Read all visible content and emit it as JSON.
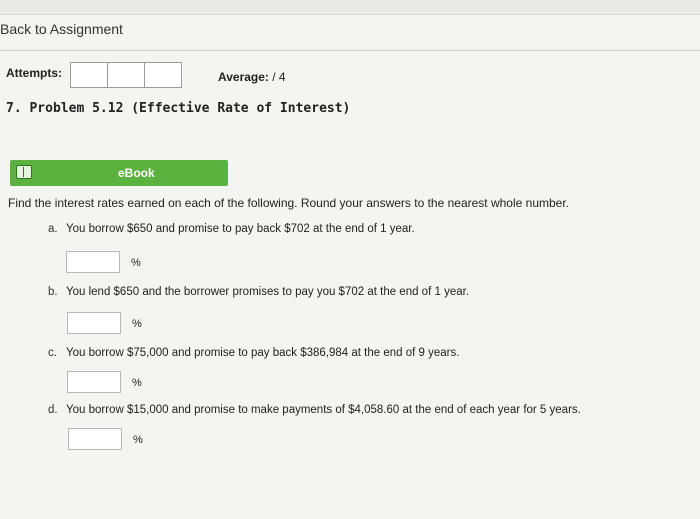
{
  "nav": {
    "back_label": "Back to Assignment"
  },
  "header": {
    "attempts_label": "Attempts:",
    "average_label": "Average:",
    "average_value": "/ 4"
  },
  "problem": {
    "title": "7. Problem 5.12 (Effective Rate of Interest)"
  },
  "ebook": {
    "label": "eBook"
  },
  "instructions": "Find the interest rates earned on each of the following. Round your answers to the nearest whole number.",
  "questions": [
    {
      "letter": "a.",
      "text": "You borrow $650 and promise to pay back $702 at the end of 1 year.",
      "unit": "%",
      "value": ""
    },
    {
      "letter": "b.",
      "text": "You lend $650 and the borrower promises to pay you $702 at the end of 1 year.",
      "unit": "%",
      "value": ""
    },
    {
      "letter": "c.",
      "text": "You borrow $75,000 and promise to pay back $386,984 at the end of 9 years.",
      "unit": "%",
      "value": ""
    },
    {
      "letter": "d.",
      "text": "You borrow $15,000 and promise to make payments of $4,058.60 at the end of each year for 5 years.",
      "unit": "%",
      "value": ""
    }
  ],
  "colors": {
    "ebook_green": "#5cb23f",
    "background": "#f4f4f2"
  }
}
